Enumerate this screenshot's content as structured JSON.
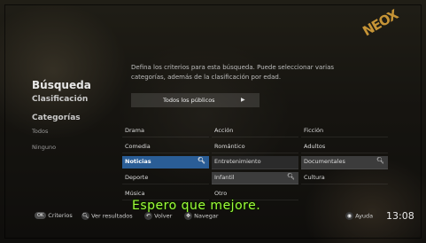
{
  "brand_logo": "NEOX",
  "panel": {
    "title": "Búsqueda",
    "description_line1": "Defina los criterios para esta búsqueda. Puede seleccionar varias",
    "description_line2": "categorías, además de la clasificación por edad.",
    "sidebar": {
      "clasificacion": "Clasificación",
      "categorias": "Categorías",
      "todos": "Todos",
      "ninguno": "Ninguno"
    },
    "rating_selector": "Todos los públicos"
  },
  "categories": {
    "col1": [
      "Drama",
      "Comedia",
      "Noticias",
      "Deporte",
      "Música"
    ],
    "col2": [
      "Acción",
      "Romántico",
      "Entretenimiento",
      "Infantil",
      "Otro"
    ],
    "col3": [
      "Ficción",
      "Adultos",
      "Documentales",
      "Cultura"
    ]
  },
  "subtitle": "Espero que mejore.",
  "bottom_bar": {
    "ok_key": "OK",
    "criterios": "Criterios",
    "ver_resultados": "Ver resultados",
    "volver": "Volver",
    "navegar": "Navegar",
    "ayuda": "Ayuda",
    "clock": "13:08"
  },
  "colors": {
    "highlight": "#2a5d96",
    "subtitle": "#9dff3a"
  }
}
